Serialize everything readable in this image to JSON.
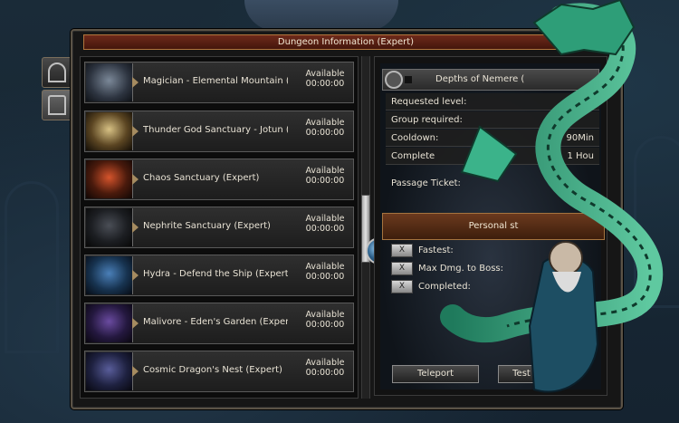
{
  "window": {
    "title": "Dungeon Information (Expert)"
  },
  "dungeon_list": [
    {
      "name": "Magician - Elemental Mountain (Ex",
      "status": "Available",
      "timer": "00:00:00"
    },
    {
      "name": "Thunder God Sanctuary - Jotun (E",
      "status": "Available",
      "timer": "00:00:00"
    },
    {
      "name": "Chaos Sanctuary (Expert)",
      "status": "Available",
      "timer": "00:00:00"
    },
    {
      "name": "Nephrite Sanctuary (Expert)",
      "status": "Available",
      "timer": "00:00:00"
    },
    {
      "name": "Hydra - Defend the Ship (Expert)",
      "status": "Available",
      "timer": "00:00:00"
    },
    {
      "name": "Malivore - Eden's Garden (Expert)",
      "status": "Available",
      "timer": "00:00:00"
    },
    {
      "name": "Cosmic Dragon's Nest (Expert)",
      "status": "Available",
      "timer": "00:00:00"
    }
  ],
  "detail": {
    "dungeon_name": "Depths of Nemere (",
    "rows": [
      {
        "label": "Requested level:",
        "value": ""
      },
      {
        "label": "Group required:",
        "value": ""
      },
      {
        "label": "Cooldown:",
        "value": "90Min"
      },
      {
        "label": "Complete",
        "value": "1 Hou"
      }
    ],
    "passage_ticket": "Passage Ticket:",
    "personal_button": "Personal st",
    "stats": [
      {
        "label": "Fastest:"
      },
      {
        "label": "Max Dmg. to Boss:"
      },
      {
        "label": "Completed:"
      }
    ],
    "teleport_button": "Teleport",
    "test_button": "Test"
  },
  "colors": {
    "title_bar": "#6e2a1a",
    "accent_gold": "#b0753d",
    "text": "#e8e2d4"
  },
  "icons": [
    "arch-door-icon",
    "gate-icon",
    "clock-icon",
    "scroll-orb-icon"
  ]
}
